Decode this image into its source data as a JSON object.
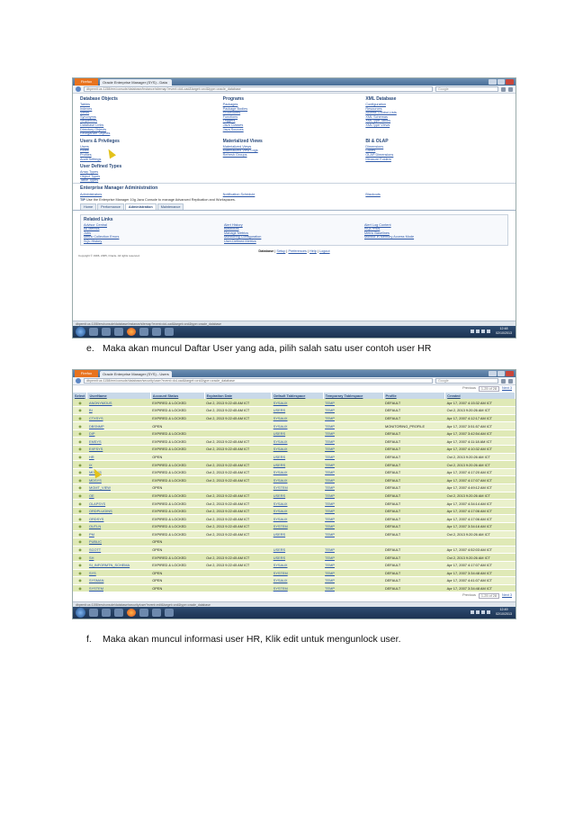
{
  "screenshot1": {
    "browser": {
      "app_button": "Firefox",
      "tab_title": "Oracle Enterprise Manager (SYS) - Data",
      "url": "dbpemit:us:1158/em/console/database/instance/sitemap?event=doLoad&target=orcl&type=oracle_database",
      "search_placeholder": "Google"
    },
    "db_objects": {
      "title": "Database Objects",
      "items": [
        "Tables",
        "Indexes",
        "Views",
        "Synonyms",
        "Sequences",
        "Database Links",
        "Directory Objects",
        "Reorganize Objects"
      ]
    },
    "programs": {
      "title": "Programs",
      "items": [
        "Packages",
        "Package Bodies",
        "Procedures",
        "Functions",
        "Triggers",
        "Java Classes",
        "Java Sources"
      ]
    },
    "xml_db": {
      "title": "XML Database",
      "items": [
        "Configuration",
        "Resources",
        "Access Control Lists",
        "XML Schemas",
        "XMLType Tables",
        "XMLType Views"
      ]
    },
    "users_privs": {
      "title": "Users & Privileges",
      "items": [
        "Users",
        "Roles",
        "Profiles",
        "Audit Settings"
      ]
    },
    "mviews": {
      "title": "Materialized Views",
      "items": [
        "Materialized Views",
        "Materialized View Logs",
        "Refresh Groups"
      ]
    },
    "bi_olap": {
      "title": "BI & OLAP",
      "items": [
        "Dimensions",
        "Cubes",
        "OLAP Dimensions",
        "Measure Folders"
      ]
    },
    "udt": {
      "title": "User Defined Types",
      "items": [
        "Array Types",
        "Object Types",
        "Table Types"
      ]
    },
    "em_admin": {
      "title": "Enterprise Manager Administration",
      "items": [
        "Administrators",
        "Notification Schedule",
        "Blackouts"
      ]
    },
    "tip": {
      "label": "TIP",
      "text": "Use the Enterprise Manager 10g Java Console to manage Advanced Replication and Workspaces."
    },
    "tabs": [
      "Home",
      "Performance",
      "Administration",
      "Maintenance"
    ],
    "related": {
      "title": "Related Links",
      "col1": [
        "Advisor Central",
        "All Metrics",
        "Jobs",
        "Metric Collection Errors",
        "SQL History"
      ],
      "col2": [
        "Alert History",
        "Blackouts",
        "Manage Metrics",
        "Monitoring Configuration",
        "User-Defined Metrics"
      ],
      "col3": [
        "Alert Log Content",
        "iSQL*Plus",
        "Metric Baselines",
        "Monitor in Memory Access Mode"
      ]
    },
    "footer_links": {
      "database": "Database",
      "setup": "Setup",
      "preferences": "Preferences",
      "help": "Help",
      "logout": "Logout"
    },
    "copyright": "Copyright © 1996, 2005, Oracle. All rights reserved.",
    "status_url": "dbpemit:us:1158/em/console/database/instance/sitemap?event=doLoad&target=orcl&type=oracle_database",
    "clock": {
      "time": "12:48",
      "date": "02/10/2013"
    }
  },
  "caption_e": {
    "label": "e.",
    "text": "Maka akan muncul Daftar User yang ada, pilih salah satu user contoh user HR"
  },
  "screenshot2": {
    "browser": {
      "app_button": "Firefox",
      "tab_title": "Oracle Enterprise Manager (SYS) - Users",
      "url": "dbpemit:us:1158/em/console/database/security/user?event=doLoad&target=orcl&type=oracle_database",
      "search_placeholder": "Google"
    },
    "pager": {
      "previous": "Previous",
      "range": "1-25 of 28",
      "next": "Next 3"
    },
    "columns": [
      "Select",
      "UserName",
      "Account Status",
      "Expiration Date",
      "Default Tablespace",
      "Temporary Tablespace",
      "Profile",
      "Created"
    ],
    "rows": [
      [
        "ANONYMOUS",
        "EXPIRED & LOCKED",
        "Oct 2, 2013 9:22:45 AM ICT",
        "SYSAUX",
        "TEMP",
        "DEFAULT",
        "Apr 17, 2007 4:15:32 AM ICT"
      ],
      [
        "BI",
        "EXPIRED & LOCKED",
        "Oct 2, 2013 9:22:45 AM ICT",
        "USERS",
        "TEMP",
        "DEFAULT",
        "Oct 2, 2013 9:20:26 AM ICT"
      ],
      [
        "CTXSYS",
        "EXPIRED & LOCKED",
        "Oct 2, 2013 9:22:45 AM ICT",
        "SYSAUX",
        "TEMP",
        "DEFAULT",
        "Apr 17, 2007 4:12:17 AM ICT"
      ],
      [
        "DBSNMP",
        "OPEN",
        "",
        "SYSAUX",
        "TEMP",
        "MONITORING_PROFILE",
        "Apr 17, 2007 3:51:57 AM ICT"
      ],
      [
        "DIP",
        "EXPIRED & LOCKED",
        "",
        "USERS",
        "TEMP",
        "DEFAULT",
        "Apr 17, 2007 3:42:54 AM ICT"
      ],
      [
        "EMSYS",
        "EXPIRED & LOCKED",
        "Oct 2, 2013 9:22:45 AM ICT",
        "SYSAUX",
        "TEMP",
        "DEFAULT",
        "Apr 17, 2007 4:11:18 AM ICT"
      ],
      [
        "EXFSYS",
        "EXPIRED & LOCKED",
        "Oct 2, 2013 9:22:45 AM ICT",
        "SYSAUX",
        "TEMP",
        "DEFAULT",
        "Apr 17, 2007 4:10:32 AM ICT"
      ],
      [
        "HR",
        "OPEN",
        "",
        "USERS",
        "TEMP",
        "DEFAULT",
        "Oct 2, 2013 9:20:26 AM ICT"
      ],
      [
        "IX",
        "EXPIRED & LOCKED",
        "Oct 2, 2013 9:22:45 AM ICT",
        "USERS",
        "TEMP",
        "DEFAULT",
        "Oct 2, 2013 9:20:26 AM ICT"
      ],
      [
        "MDSYS",
        "EXPIRED & LOCKED",
        "Oct 2, 2013 9:22:45 AM ICT",
        "SYSAUX",
        "TEMP",
        "DEFAULT",
        "Apr 17, 2007 4:17:20 AM ICT"
      ],
      [
        "MDSYS",
        "EXPIRED & LOCKED",
        "Oct 2, 2013 9:22:45 AM ICT",
        "SYSAUX",
        "TEMP",
        "DEFAULT",
        "Apr 17, 2007 4:17:07 AM ICT"
      ],
      [
        "MGMT_VIEW",
        "OPEN",
        "",
        "SYSTEM",
        "TEMP",
        "DEFAULT",
        "Apr 17, 2007 4:49:12 AM ICT"
      ],
      [
        "OE",
        "EXPIRED & LOCKED",
        "Oct 2, 2013 9:22:45 AM ICT",
        "USERS",
        "TEMP",
        "DEFAULT",
        "Oct 2, 2013 9:20:26 AM ICT"
      ],
      [
        "OLAPSYS",
        "EXPIRED & LOCKED",
        "Oct 2, 2013 9:22:45 AM ICT",
        "SYSAUX",
        "TEMP",
        "DEFAULT",
        "Apr 17, 2007 4:34:14 AM ICT"
      ],
      [
        "ORDPLUGINS",
        "EXPIRED & LOCKED",
        "Oct 2, 2013 9:22:45 AM ICT",
        "SYSAUX",
        "TEMP",
        "DEFAULT",
        "Apr 17, 2007 4:17:06 AM ICT"
      ],
      [
        "ORDSYS",
        "EXPIRED & LOCKED",
        "Oct 2, 2013 9:22:45 AM ICT",
        "SYSAUX",
        "TEMP",
        "DEFAULT",
        "Apr 17, 2007 4:17:06 AM ICT"
      ],
      [
        "OUTLN",
        "EXPIRED & LOCKED",
        "Oct 2, 2013 9:22:45 AM ICT",
        "SYSTEM",
        "TEMP",
        "DEFAULT",
        "Apr 17, 2007 3:34:16 AM ICT"
      ],
      [
        "PM",
        "EXPIRED & LOCKED",
        "Oct 2, 2013 9:22:45 AM ICT",
        "USERS",
        "TEMP",
        "DEFAULT",
        "Oct 2, 2013 9:20:26 AM ICT"
      ],
      [
        "PUBLIC",
        "OPEN",
        "",
        "",
        "",
        "",
        ""
      ],
      [
        "SCOTT",
        "OPEN",
        "",
        "USERS",
        "TEMP",
        "DEFAULT",
        "Apr 17, 2007 4:52:03 AM ICT"
      ],
      [
        "SH",
        "EXPIRED & LOCKED",
        "Oct 2, 2013 9:22:45 AM ICT",
        "USERS",
        "TEMP",
        "DEFAULT",
        "Oct 2, 2013 9:20:26 AM ICT"
      ],
      [
        "SI_INFORMTN_SCHEMA",
        "EXPIRED & LOCKED",
        "Oct 2, 2013 9:22:45 AM ICT",
        "SYSAUX",
        "TEMP",
        "DEFAULT",
        "Apr 17, 2007 4:17:07 AM ICT"
      ],
      [
        "SYS",
        "OPEN",
        "",
        "SYSTEM",
        "TEMP",
        "DEFAULT",
        "Apr 17, 2007 3:34:48 AM ICT"
      ],
      [
        "SYSMAN",
        "OPEN",
        "",
        "SYSAUX",
        "TEMP",
        "DEFAULT",
        "Apr 17, 2007 4:41:07 AM ICT"
      ],
      [
        "SYSTEM",
        "OPEN",
        "",
        "SYSTEM",
        "TEMP",
        "DEFAULT",
        "Apr 17, 2007 3:34:48 AM ICT"
      ]
    ],
    "status_url": "dbpemit:us:1158/em/console/database/security/user?event=edit&target=orcl&type=oracle_database",
    "clock": {
      "time": "12:49",
      "date": "02/10/2013"
    }
  },
  "caption_f": {
    "label": "f.",
    "text": "Maka akan muncul informasi user HR, Klik edit untuk mengunlock user."
  }
}
